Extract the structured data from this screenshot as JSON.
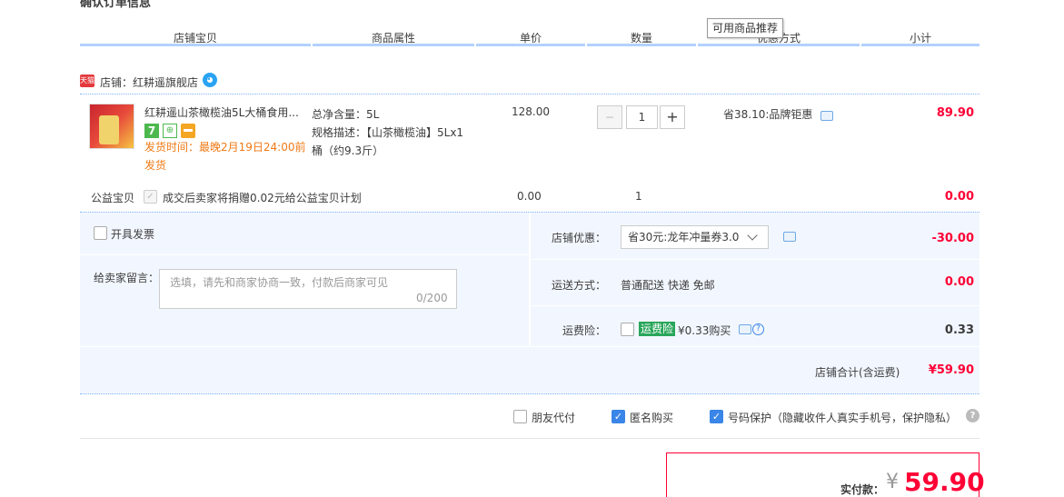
{
  "section_title": "确认订单信息",
  "columns": [
    "店铺宝贝",
    "商品属性",
    "单价",
    "数量",
    "优惠方式",
    "小计"
  ],
  "tooltip": "可用商品推荐",
  "shop": {
    "badge": "天猫",
    "name": "店铺：红耕遥旗舰店"
  },
  "item": {
    "title": "红耕遥山茶橄榄油5L大桶食用...",
    "service_badge_7": "7",
    "ship_text": "发货时间：最晚2月19日24:00前发货",
    "attr_weight": "总净含量：5L",
    "attr_spec_line1": "规格描述：【山茶橄榄油】5Lx1",
    "attr_spec_line2": "桶（约9.3斤）",
    "price": "128.00",
    "quantity": "1",
    "discount": "省38.10:品牌钜惠",
    "subtotal": "89.90"
  },
  "public_welfare": {
    "label": "公益宝贝",
    "text": "成交后卖家将捐赠0.02元给公益宝贝计划",
    "price": "0.00",
    "quantity": "1",
    "subtotal": "0.00"
  },
  "invoice_label": "开具发票",
  "message": {
    "label": "给卖家留言：",
    "placeholder": "选填，请先和商家协商一致，付款后商家可见",
    "count": "0/200"
  },
  "shop_discount": {
    "label": "店铺优惠：",
    "selected": "省30元:龙年冲量券3.0",
    "amount": "-30.00"
  },
  "shipping": {
    "label": "运送方式：",
    "value": "普通配送 快递 免邮",
    "amount": "0.00"
  },
  "insurance": {
    "label": "运费险：",
    "tag": "运费险",
    "text": "¥0.33购买",
    "amount": "0.33"
  },
  "shop_total": {
    "label": "店铺合计(含运费)",
    "amount": "¥59.90"
  },
  "options": {
    "friend_pay": "朋友代付",
    "anonymous": "匿名购买",
    "number_protect": "号码保护（隐藏收件人真实手机号，保护隐私）"
  },
  "payment": {
    "label": "实付款：",
    "symbol": "¥",
    "amount": "59.90"
  },
  "colors": {
    "accent_red": "#ff0036",
    "accent_blue": "#3a85e8",
    "panel_bg": "#f2f7ff"
  }
}
